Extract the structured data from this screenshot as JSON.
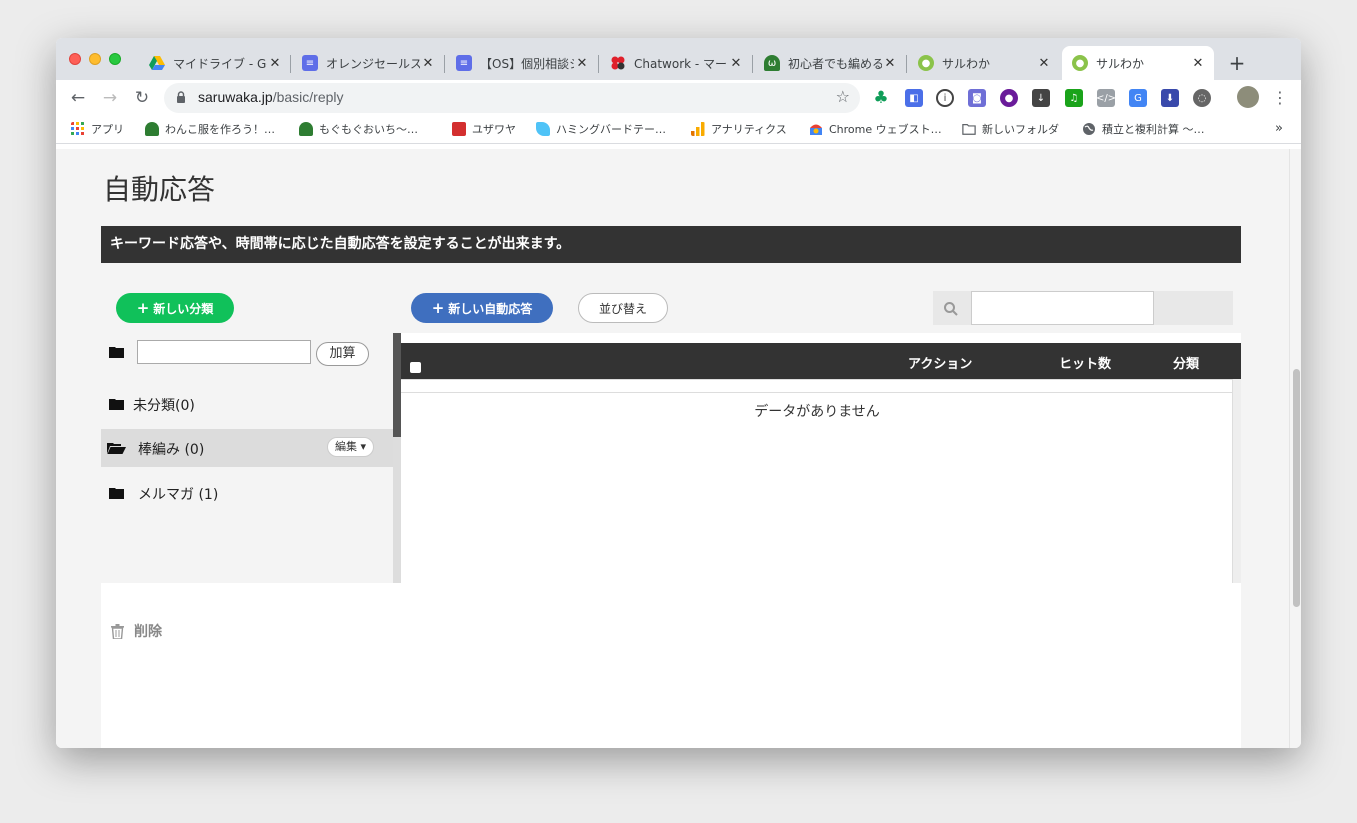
{
  "browser": {
    "tabs": [
      {
        "title": "マイドライブ - Google",
        "color": "#f4b400"
      },
      {
        "title": "オレンジセールスブ",
        "color": "#5f6ee8"
      },
      {
        "title": "【OS】個別相談シ",
        "color": "#5f6ee8"
      },
      {
        "title": "Chatwork - マー",
        "color": "#e0202b"
      },
      {
        "title": "初心者でも編める",
        "color": "#2e7d32"
      },
      {
        "title": "サルわか",
        "color": "#8bc34a"
      },
      {
        "title": "サルわか",
        "color": "#8bc34a"
      }
    ],
    "tab_close": "✕",
    "new_tab": "+",
    "url_host": "saruwaka.jp",
    "url_path": "/basic/reply",
    "bookmarks": [
      {
        "label": "アプリ",
        "color": "#e94235"
      },
      {
        "label": "わんこ服を作ろう！…",
        "color": "#2e7d32"
      },
      {
        "label": "もぐもぐおいち〜…",
        "color": "#2e7d32"
      },
      {
        "label": "ユザワヤ",
        "color": "#d32f2f"
      },
      {
        "label": "ハミングバードテー…",
        "color": "#4fc3f7"
      },
      {
        "label": "アナリティクス",
        "color": "#f9ab00"
      },
      {
        "label": "Chrome ウェブスト…",
        "color": "#4285f4"
      },
      {
        "label": "新しいフォルダ",
        "color": "#5f6368"
      },
      {
        "label": "積立と複利計算 〜…",
        "color": "#5f6368"
      }
    ],
    "bookmarks_more": "»"
  },
  "page": {
    "title": "自動応答",
    "banner": "キーワード応答や、時間帯に応じた自動応答を設定することが出来ます。",
    "new_category_label": "新しい分類",
    "new_reply_label": "新しい自動応答",
    "sort_label": "並び替え",
    "sidebar": {
      "add_label": "加算",
      "items": [
        {
          "label": "未分類(0)"
        },
        {
          "label": "棒編み (0)",
          "action": "編集"
        },
        {
          "label": "メルマガ (1)"
        }
      ]
    },
    "table": {
      "columns": [
        "アクション",
        "ヒット数",
        "分類"
      ],
      "empty_text": "データがありません"
    },
    "delete_label": "削除"
  }
}
